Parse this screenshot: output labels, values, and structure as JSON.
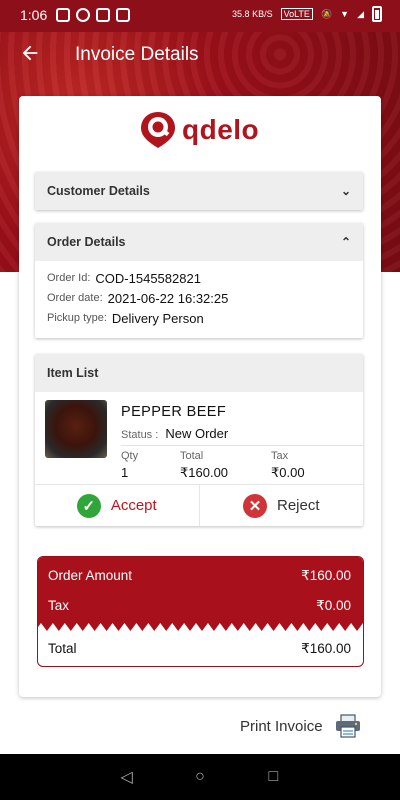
{
  "status_bar": {
    "time": "1:06",
    "network_speed": "35.8 KB/S",
    "left_icons": [
      "flipboard-icon",
      "whatsapp-icon",
      "calendar-icon",
      "image-icon"
    ],
    "right_icons": [
      "volte-icon",
      "mute-icon",
      "wifi-icon",
      "signal-icon",
      "battery-icon"
    ]
  },
  "appbar": {
    "title": "Invoice Details"
  },
  "logo": {
    "text": "qdelo"
  },
  "sections": {
    "customer": {
      "title": "Customer Details"
    },
    "order": {
      "title": "Order Details",
      "rows": [
        {
          "label": "Order Id:",
          "value": "COD-1545582821"
        },
        {
          "label": "Order date:",
          "value": "2021-06-22 16:32:25"
        },
        {
          "label": "Pickup type:",
          "value": "Delivery Person"
        }
      ]
    },
    "items": {
      "title": "Item List",
      "list": [
        {
          "name": "PEPPER BEEF",
          "status_label": "Status :",
          "status": "New Order",
          "qty_label": "Qty",
          "qty": "1",
          "total_label": "Total",
          "total": "₹160.00",
          "tax_label": "Tax",
          "tax": "₹0.00"
        }
      ],
      "accept_label": "Accept",
      "reject_label": "Reject"
    }
  },
  "summary": {
    "order_amount_label": "Order Amount",
    "order_amount": "₹160.00",
    "tax_label": "Tax",
    "tax": "₹0.00",
    "total_label": "Total",
    "total": "₹160.00"
  },
  "print": {
    "label": "Print Invoice"
  },
  "colors": {
    "brand": "#a8111b",
    "accept": "#2fa53a",
    "reject": "#d13438"
  }
}
